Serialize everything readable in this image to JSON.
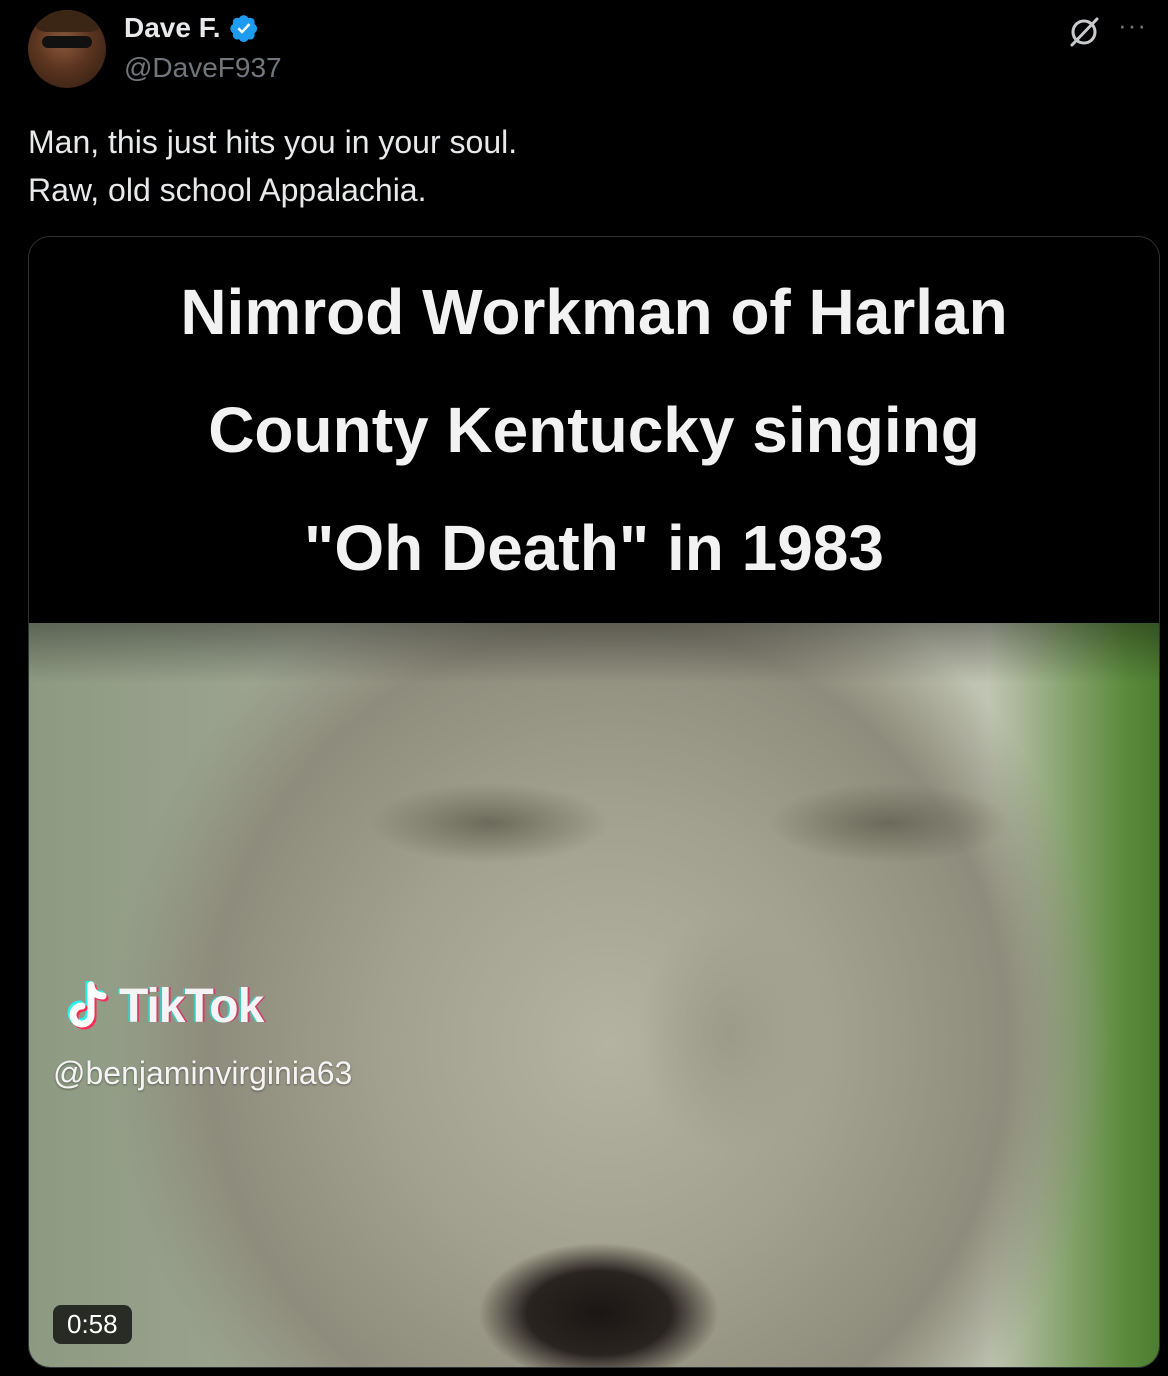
{
  "author": {
    "display_name": "Dave F.",
    "handle": "@DaveF937",
    "verified": true,
    "verified_color": "#1d9bf0"
  },
  "tweet": {
    "text": "Man, this just hits you in your soul.\nRaw, old school Appalachia."
  },
  "icons": {
    "grok": "grok-icon",
    "more": "more-icon"
  },
  "media": {
    "caption_lines": [
      "Nimrod Workman of Harlan",
      "County Kentucky singing",
      "\"Oh Death\" in 1983"
    ],
    "watermark_brand": "TikTok",
    "watermark_user": "@benjaminvirginia63",
    "duration": "0:58"
  }
}
